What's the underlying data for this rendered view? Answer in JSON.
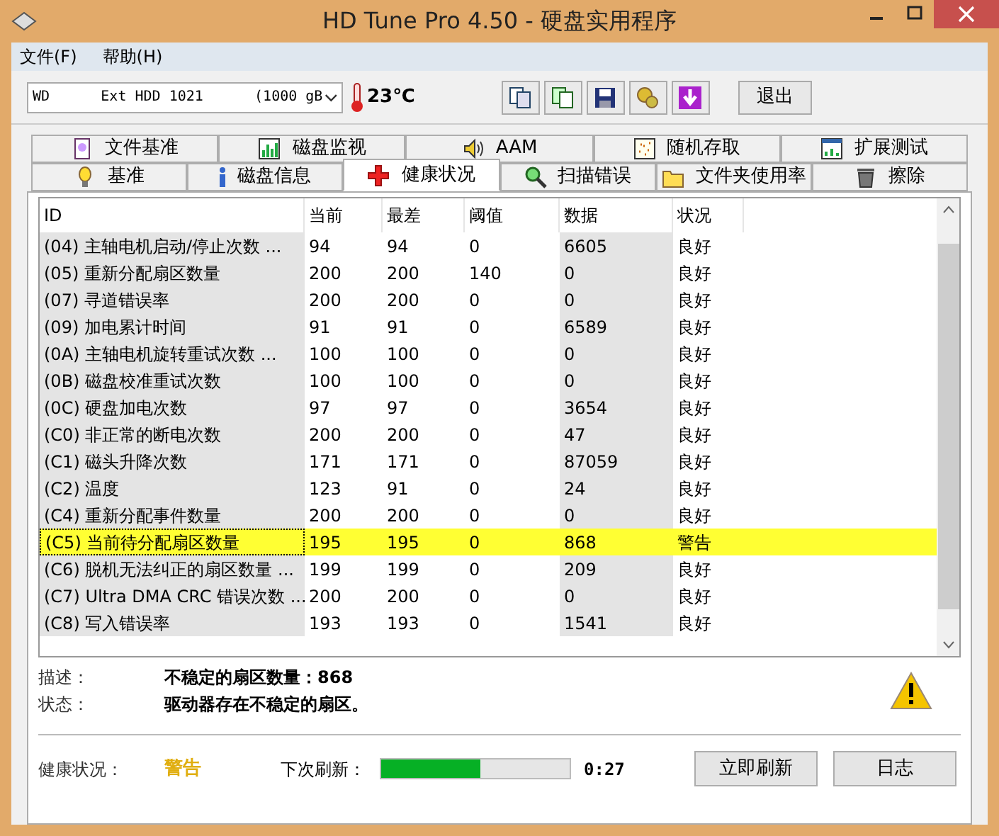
{
  "window": {
    "title": "HD Tune Pro 4.50 - 硬盘实用程序"
  },
  "menu": [
    {
      "label": "文件(F)"
    },
    {
      "label": "帮助(H)"
    }
  ],
  "toolbar": {
    "drive": "WD      Ext HDD 1021      (1000 gB",
    "temperature": "23℃",
    "tools": [
      {
        "kind": "copy"
      },
      {
        "kind": "copy-all"
      },
      {
        "kind": "save"
      },
      {
        "kind": "options"
      },
      {
        "kind": "download"
      }
    ],
    "exit": "退出"
  },
  "tabs_top": [
    {
      "label": "文件基准",
      "kind": "file",
      "selected": false
    },
    {
      "label": "磁盘监视",
      "kind": "monitor",
      "selected": false
    },
    {
      "label": "AAM",
      "kind": "speaker",
      "selected": false
    },
    {
      "label": "随机存取",
      "kind": "random",
      "selected": false
    },
    {
      "label": "扩展测试",
      "kind": "extra",
      "selected": false
    }
  ],
  "tabs_bottom": [
    {
      "label": "基准",
      "kind": "bulb",
      "selected": false
    },
    {
      "label": "磁盘信息",
      "kind": "info",
      "selected": false
    },
    {
      "label": "健康状况",
      "kind": "health",
      "selected": true
    },
    {
      "label": "扫描错误",
      "kind": "scan",
      "selected": false
    },
    {
      "label": "文件夹使用率",
      "kind": "folder",
      "selected": false
    },
    {
      "label": "擦除",
      "kind": "trash",
      "selected": false
    }
  ],
  "table": {
    "columns": [
      "ID",
      "当前",
      "最差",
      "阈值",
      "数据",
      "状况"
    ],
    "rows": [
      {
        "cells": [
          "(04) 主轴电机启动/停止次数 ...",
          "94",
          "94",
          "0",
          "6605",
          "良好"
        ],
        "selected": false
      },
      {
        "cells": [
          "(05) 重新分配扇区数量",
          "200",
          "200",
          "140",
          "0",
          "良好"
        ],
        "selected": false
      },
      {
        "cells": [
          "(07) 寻道错误率",
          "200",
          "200",
          "0",
          "0",
          "良好"
        ],
        "selected": false
      },
      {
        "cells": [
          "(09) 加电累计时间",
          "91",
          "91",
          "0",
          "6589",
          "良好"
        ],
        "selected": false
      },
      {
        "cells": [
          "(0A) 主轴电机旋转重试次数 ...",
          "100",
          "100",
          "0",
          "0",
          "良好"
        ],
        "selected": false
      },
      {
        "cells": [
          "(0B) 磁盘校准重试次数",
          "100",
          "100",
          "0",
          "0",
          "良好"
        ],
        "selected": false
      },
      {
        "cells": [
          "(0C) 硬盘加电次数",
          "97",
          "97",
          "0",
          "3654",
          "良好"
        ],
        "selected": false
      },
      {
        "cells": [
          "(C0) 非正常的断电次数",
          "200",
          "200",
          "0",
          "47",
          "良好"
        ],
        "selected": false
      },
      {
        "cells": [
          "(C1) 磁头升降次数",
          "171",
          "171",
          "0",
          "87059",
          "良好"
        ],
        "selected": false
      },
      {
        "cells": [
          "(C2) 温度",
          "123",
          "91",
          "0",
          "24",
          "良好"
        ],
        "selected": false
      },
      {
        "cells": [
          "(C4) 重新分配事件数量",
          "200",
          "200",
          "0",
          "0",
          "良好"
        ],
        "selected": false
      },
      {
        "cells": [
          "(C5) 当前待分配扇区数量",
          "195",
          "195",
          "0",
          "868",
          "警告"
        ],
        "selected": true
      },
      {
        "cells": [
          "(C6) 脱机无法纠正的扇区数量 ...",
          "199",
          "199",
          "0",
          "209",
          "良好"
        ],
        "selected": false
      },
      {
        "cells": [
          "(C7) Ultra DMA CRC 错误次数 ...",
          "200",
          "200",
          "0",
          "0",
          "良好"
        ],
        "selected": false
      },
      {
        "cells": [
          "(C8) 写入错误率",
          "193",
          "193",
          "0",
          "1541",
          "良好"
        ],
        "selected": false
      }
    ]
  },
  "details": [
    {
      "label": "描述：",
      "value": "不稳定的扇区数量：868"
    },
    {
      "label": "状态：",
      "value": "驱动器存在不稳定的扇区。"
    }
  ],
  "health": {
    "label": "健康状况：",
    "value": "警告",
    "next_refresh_label": "下次刷新：",
    "level": 0.53,
    "time": "0:27",
    "buttons": [
      "立即刷新",
      "日志"
    ]
  }
}
